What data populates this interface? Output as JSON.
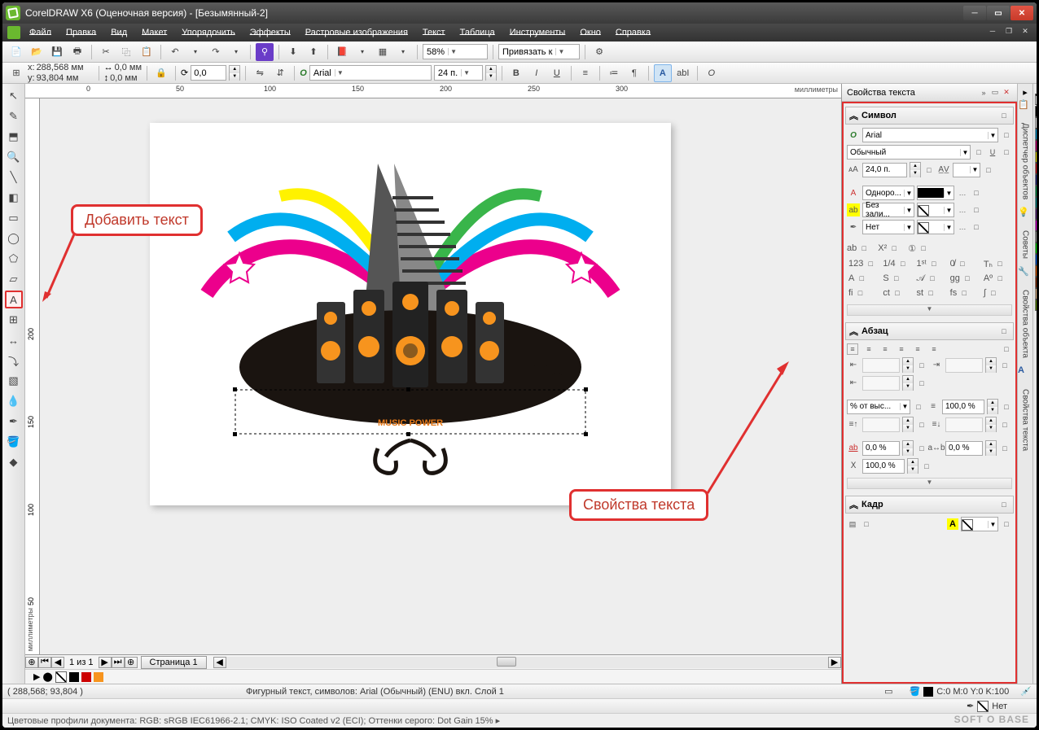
{
  "titlebar": {
    "title": "CorelDRAW X6 (Оценочная версия) - [Безымянный-2]"
  },
  "menu": [
    "Файл",
    "Правка",
    "Вид",
    "Макет",
    "Упорядочить",
    "Эффекты",
    "Растровые изображения",
    "Текст",
    "Таблица",
    "Инструменты",
    "Окно",
    "Справка"
  ],
  "toolbar1": {
    "zoom": "58%",
    "snap_label": "Привязать к"
  },
  "toolbar2": {
    "x_label": "x:",
    "x_val": "288,568 мм",
    "y_label": "y:",
    "y_val": "93,804 мм",
    "w_val": "0,0 мм",
    "h_val": "0,0 мм",
    "rotate": "0,0",
    "font": "Arial",
    "font_size": "24 п."
  },
  "ruler_h": {
    "unit_label": "миллиметры",
    "ticks": [
      "0",
      "50",
      "100",
      "150",
      "200",
      "250",
      "300"
    ]
  },
  "ruler_v": {
    "unit_label": "миллиметры",
    "ticks": [
      "50",
      "100",
      "150",
      "200"
    ]
  },
  "callout1": "Добавить текст",
  "callout2": "Свойства текста",
  "artwork_text": "MUSIC POWER",
  "page_tabs": {
    "count_label": "1 из 1",
    "tab": "Страница 1"
  },
  "docker": {
    "title": "Свойства текста",
    "symbol_hdr": "Символ",
    "font": "Arial",
    "style": "Обычный",
    "size": "24,0 п.",
    "fill_mode": "Одноро...",
    "bg_mode": "Без зали...",
    "outline_mode": "Нет",
    "kern_lbl": "ab",
    "sup_lbl": "X²",
    "cap_lbl": "①",
    "num_lbl": "123",
    "frac_lbl": "1/4",
    "ord_lbl": "1ˢᵗ",
    "zero_lbl": "0̸",
    "th_lbl": "Tₕ",
    "a_lbl": "A",
    "s_lbl": "S",
    "sa_lbl": "𝒜",
    "gg_lbl": "gg",
    "ao_lbl": "Aº",
    "fi_lbl": "fi",
    "ct_lbl": "ct",
    "st_lbl": "st",
    "fs_lbl": "fs",
    "lf_lbl": "∫",
    "para_hdr": "Абзац",
    "spacing_mode": "% от выс...",
    "spacing_val": "100,0 %",
    "char_sp": "0,0 %",
    "word_sp": "0,0 %",
    "line_sp": "100,0 %",
    "frame_hdr": "Кадр"
  },
  "sidetabs": [
    "Диспетчер объектов",
    "Советы",
    "Свойства объекта",
    "Свойства текста"
  ],
  "status": {
    "coords": "( 288,568; 93,804 )",
    "info": "Фигурный текст, символов: Arial (Обычный) (ENU) вкл. Слой 1",
    "fill": "C:0 M:0 Y:0 K:100",
    "outline": "Нет"
  },
  "status2": "Цветовые профили документа: RGB: sRGB IEC61966-2.1; CMYK: ISO Coated v2 (ECI); Оттенки серого: Dot Gain 15% ▸",
  "watermark": "SOFT O BASE",
  "palette": [
    "#000",
    "#fff",
    "#00aeef",
    "#ec008c",
    "#fff200",
    "#ed1c24",
    "#2e3192",
    "#00a651",
    "#009999",
    "#662d91",
    "#ff00ff",
    "#999",
    "#00ff00",
    "#0066ff",
    "#ff6600",
    "#993300",
    "#ffcc99",
    "#669900"
  ]
}
